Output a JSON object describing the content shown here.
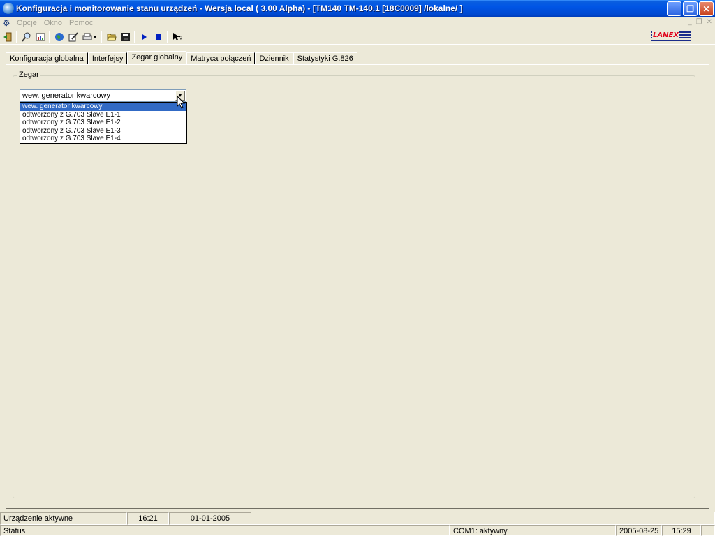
{
  "window": {
    "title": "Konfiguracja i monitorowanie stanu urządzeń  - Wersja local  ( 3.00 Alpha) - [TM140 TM-140.1 [18C0009] /lokalne/ ]",
    "minimize": "_",
    "maximize": "❐",
    "close": "✕"
  },
  "menu": {
    "items": [
      "Opcje",
      "Okno",
      "Pomoc"
    ],
    "mdi_minimize": "_",
    "mdi_restore": "❐",
    "mdi_close": "✕"
  },
  "toolbar": {
    "icons": [
      "exit-icon",
      "search-icon",
      "chart-icon",
      "globe-icon",
      "edit-icon",
      "print-icon",
      "open-folder-icon",
      "save-icon",
      "play-icon",
      "stop-icon",
      "help-icon"
    ],
    "logo_text": "LANEX"
  },
  "tabs": [
    {
      "label": "Konfiguracja globalna",
      "active": false
    },
    {
      "label": "Interfejsy",
      "active": false
    },
    {
      "label": "Zegar globalny",
      "active": true
    },
    {
      "label": "Matryca połączeń",
      "active": false
    },
    {
      "label": "Dziennik",
      "active": false
    },
    {
      "label": "Statystyki G.826",
      "active": false
    }
  ],
  "clock": {
    "group_label": "Zegar",
    "selected": "wew. generator kwarcowy",
    "options": [
      "wew. generator kwarcowy",
      "odtworzony z G.703 Slave  E1-1",
      "odtworzony z G.703 Slave  E1-2",
      "odtworzony z G.703 Slave  E1-3",
      "odtworzony z G.703 Slave  E1-4"
    ]
  },
  "device_status": {
    "state": "Urządzenie aktywne",
    "time": "16:21",
    "date": "01-01-2005"
  },
  "statusbar": {
    "label": "Status",
    "com": "COM1: aktywny",
    "date": "2005-08-25",
    "time": "15:29"
  }
}
